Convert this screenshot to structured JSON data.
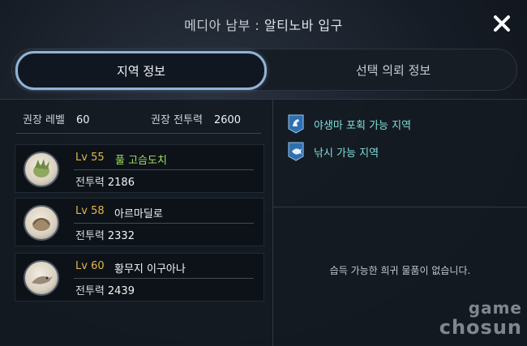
{
  "header": {
    "title_region": "메디아 남부 :",
    "title_place": "알티노바 입구"
  },
  "tabs": [
    {
      "label": "지역 정보",
      "active": true
    },
    {
      "label": "선택 의뢰 정보",
      "active": false
    }
  ],
  "region": {
    "level_label": "권장 레벨",
    "level_value": "60",
    "power_label": "권장 전투력",
    "power_value": "2600"
  },
  "monsters": [
    {
      "level": "Lv 55",
      "name": "풀 고슴도치",
      "name_color": "#9fe05a",
      "power_label": "전투력",
      "power": "2186"
    },
    {
      "level": "Lv 58",
      "name": "아르마딜로",
      "name_color": "#f2f5f8",
      "power_label": "전투력",
      "power": "2332"
    },
    {
      "level": "Lv 60",
      "name": "황무지 이구아나",
      "name_color": "#f2f5f8",
      "power_label": "전투력",
      "power": "2439"
    }
  ],
  "features": [
    {
      "label": "야생마 포획 가능 지역",
      "icon": "horse-icon"
    },
    {
      "label": "낚시 가능 지역",
      "icon": "fish-icon"
    }
  ],
  "rare_items": {
    "empty_text": "습득 가능한 희귀 물품이 없습니다."
  },
  "watermark": {
    "line1": "game",
    "line2": "chosun"
  },
  "colors": {
    "accent_tab_border": "#8fb3d6",
    "level_gold": "#e3b64a",
    "feature_cyan": "#7fe0dc"
  }
}
